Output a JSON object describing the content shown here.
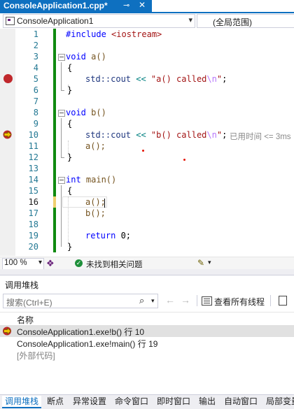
{
  "doc_tab": {
    "title": "ConsoleApplication1.cpp*",
    "pin": "⊸",
    "close": "✕"
  },
  "nav": {
    "project": "ConsoleApplication1",
    "scope": "(全局范围)",
    "arrow": "▾"
  },
  "editor": {
    "lines": [
      {
        "n": "1"
      },
      {
        "n": "2"
      },
      {
        "n": "3"
      },
      {
        "n": "4"
      },
      {
        "n": "5"
      },
      {
        "n": "6"
      },
      {
        "n": "7"
      },
      {
        "n": "8"
      },
      {
        "n": "9"
      },
      {
        "n": "10"
      },
      {
        "n": "11"
      },
      {
        "n": "12"
      },
      {
        "n": "13"
      },
      {
        "n": "14"
      },
      {
        "n": "15"
      },
      {
        "n": "16"
      },
      {
        "n": "17"
      },
      {
        "n": "18"
      },
      {
        "n": "19"
      },
      {
        "n": "20"
      }
    ],
    "code": {
      "l1_dir": "#include ",
      "l1_hdr": "<iostream>",
      "l3_kw": "void",
      "l3_rest": " a()",
      "l4": "{",
      "l5_a": "std::cout ",
      "l5_op": "<<",
      "l5_str1": " \"a() called",
      "l5_esc": "\\n",
      "l5_str2": "\"",
      "l5_end": ";",
      "l6": "}",
      "l8_kw": "void",
      "l8_rest": " b()",
      "l9": "{",
      "l10_a": "std::cout ",
      "l10_op": "<<",
      "l10_str1": " \"b() called",
      "l10_esc": "\\n",
      "l10_str2": "\"",
      "l10_end": ";",
      "l10_perf": "已用时间 <= 3ms",
      "l11": "a();",
      "l12": "}",
      "l14_kw": "int",
      "l14_rest": " main()",
      "l15": "{",
      "l16": "a();",
      "l17": "b();",
      "l19_kw": "return",
      "l19_rest": " 0;",
      "l20": "}"
    }
  },
  "status": {
    "zoom": "100 %",
    "zoom_arrow": "▾",
    "issues": "未找到相关问题",
    "ok_glyph": "✓",
    "brush_arrow": "▾"
  },
  "call_stack": {
    "title": "调用堆栈",
    "search_placeholder": "搜索(Ctrl+E)",
    "search_glyph": "⌕",
    "search_arrow": "▾",
    "back": "←",
    "forward": "→",
    "view_all_threads": "查看所有线程",
    "column_name": "名称",
    "frames": [
      {
        "text": "ConsoleApplication1.exe!b() 行 10",
        "current": true
      },
      {
        "text": "ConsoleApplication1.exe!main() 行 19",
        "current": false
      },
      {
        "text": "[外部代码]",
        "current": false
      }
    ]
  },
  "bottom_tabs": [
    "调用堆栈",
    "断点",
    "异常设置",
    "命令窗口",
    "即时窗口",
    "输出",
    "自动窗口",
    "局部变量"
  ],
  "colors": {
    "accent": "#0e70c0",
    "change_bar": "#108a10",
    "breakpoint": "#c0282c",
    "instruction_pointer": "#f2c200"
  }
}
